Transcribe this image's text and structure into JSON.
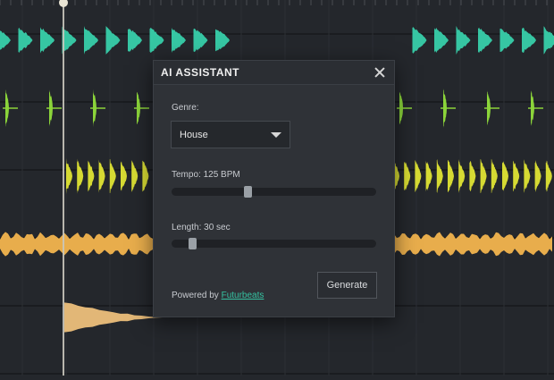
{
  "dialog": {
    "title": "AI ASSISTANT",
    "close_icon": "close-icon",
    "genre_label": "Genre:",
    "genre_value": "House",
    "tempo_label": "Tempo: 125 BPM",
    "tempo_level": 0.37,
    "length_label": "Length: 30 sec",
    "length_level": 0.1,
    "powered_prefix": "Powered by ",
    "powered_link": "Futurbeats",
    "generate_label": "Generate"
  },
  "tracks": [
    {
      "color": "#36c6a3",
      "pattern": "kick"
    },
    {
      "color": "#8bd43a",
      "pattern": "snare"
    },
    {
      "color": "#d6da33",
      "pattern": "hat"
    },
    {
      "color": "#e8ad4c",
      "pattern": "loop"
    },
    {
      "color": "#e2b777",
      "pattern": "fx"
    },
    {
      "color": "#e8b35a",
      "pattern": "perc"
    }
  ],
  "colors": {
    "background": "#24272c",
    "dialog_bg": "#2f3237",
    "link": "#35c3a2"
  }
}
